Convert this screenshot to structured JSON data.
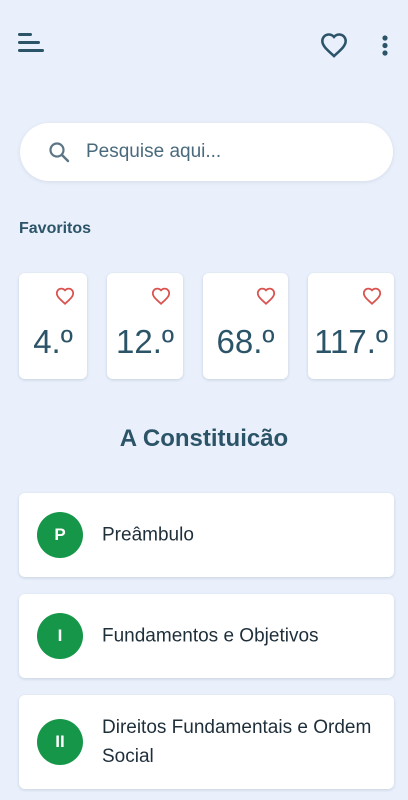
{
  "header": {
    "menu_icon": "menu-icon",
    "favorites_icon": "heart-outline-icon",
    "more_icon": "more-vertical-icon"
  },
  "search": {
    "placeholder": "Pesquise aqui...",
    "icon": "search-icon"
  },
  "favorites": {
    "label": "Favoritos",
    "items": [
      {
        "number": "4.º"
      },
      {
        "number": "12.º"
      },
      {
        "number": "68.º"
      },
      {
        "number": "117.º"
      }
    ]
  },
  "main": {
    "title": "A Constituicão",
    "sections": [
      {
        "badge": "P",
        "label": "Preâmbulo"
      },
      {
        "badge": "I",
        "label": "Fundamentos e Objetivos"
      },
      {
        "badge": "II",
        "label": "Direitos Fundamentais e Ordem Social"
      }
    ]
  },
  "colors": {
    "background": "#eaf0fb",
    "primary_text": "#2c5468",
    "badge_green": "#169648",
    "heart_red": "#d9534f"
  }
}
